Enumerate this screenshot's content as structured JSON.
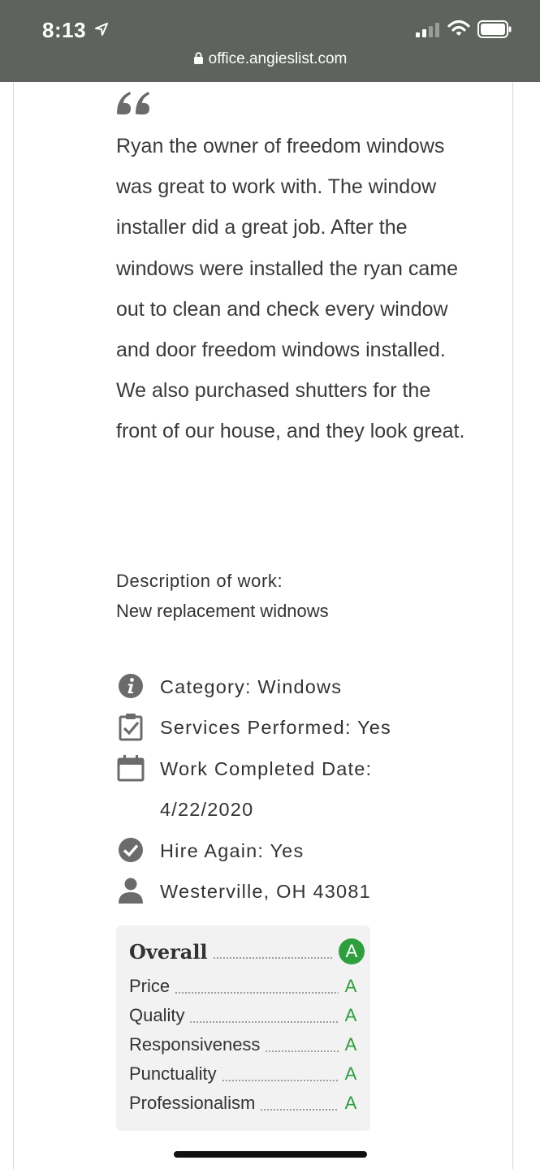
{
  "status_bar": {
    "time": "8:13",
    "url": "office.angieslist.com"
  },
  "review": {
    "text": "Ryan the owner of freedom windows was great to work with. The window installer did a great job. After the windows were installed the ryan came out to clean and check every window and door freedom windows installed. We also purchased shutters for the front of our house, and they look great.",
    "description_title": "Description of work:",
    "description": "New replacement widnows"
  },
  "details": [
    {
      "icon": "info-icon",
      "text": "Category: Windows"
    },
    {
      "icon": "clipboard-check-icon",
      "text": "Services Performed: Yes"
    },
    {
      "icon": "calendar-icon",
      "text": "Work Completed Date:"
    },
    {
      "icon": "",
      "text": "4/22/2020"
    },
    {
      "icon": "check-circle-icon",
      "text": "Hire Again: Yes"
    },
    {
      "icon": "person-icon",
      "text": "Westerville, OH 43081"
    }
  ],
  "grades": {
    "overall_label": "Overall",
    "overall_value": "A",
    "rows": [
      {
        "label": "Price",
        "value": "A"
      },
      {
        "label": "Quality",
        "value": "A"
      },
      {
        "label": "Responsiveness",
        "value": "A"
      },
      {
        "label": "Punctuality",
        "value": "A"
      },
      {
        "label": "Professionalism",
        "value": "A"
      }
    ]
  },
  "colors": {
    "status_bar_bg": "#5e635e",
    "grade_green": "#2e9e3e",
    "grade_panel_bg": "#f2f2f2",
    "icon_gray": "#6b6b6b"
  }
}
